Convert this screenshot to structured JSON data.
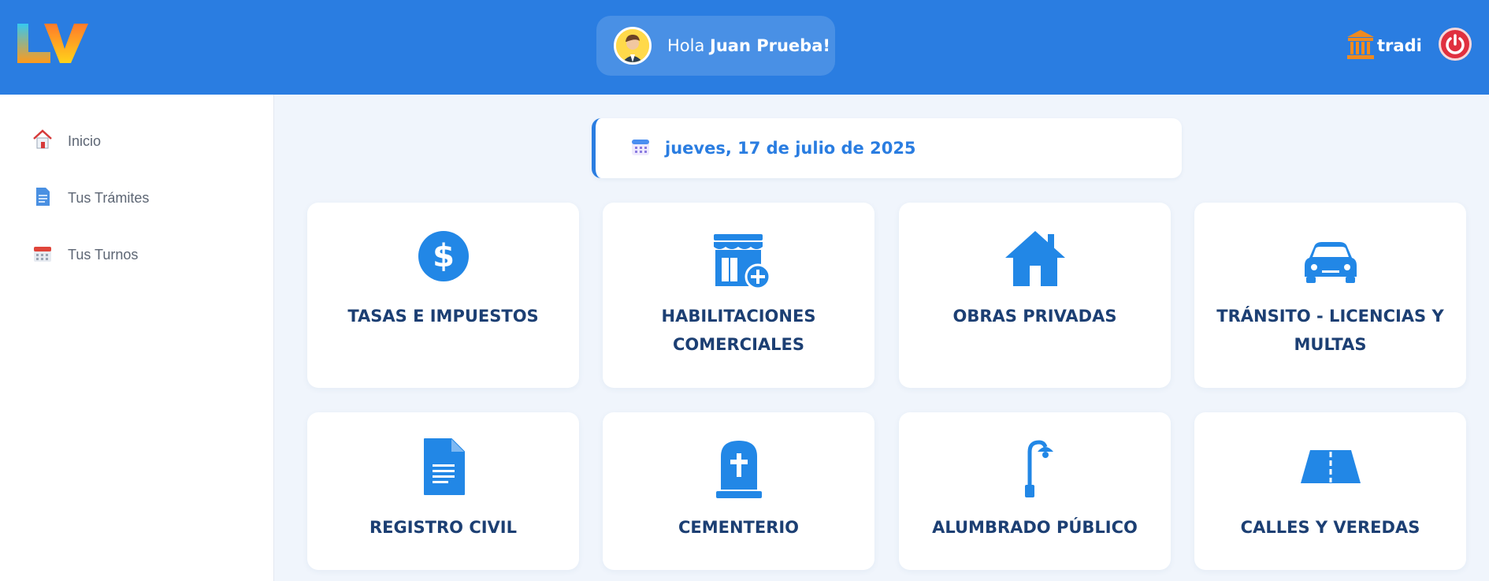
{
  "header": {
    "greeting_prefix": "Hola",
    "user_name": "Juan Prueba!",
    "brand": "tradi",
    "accent": "#2a7de1",
    "logo_icon": "lv-logo-icon",
    "power_icon": "power-icon"
  },
  "sidebar": {
    "items": [
      {
        "label": "Inicio",
        "icon": "home-icon"
      },
      {
        "label": "Tus Trámites",
        "icon": "document-icon"
      },
      {
        "label": "Tus Turnos",
        "icon": "calendar-icon"
      }
    ]
  },
  "date": "jueves, 17 de julio de 2025",
  "cards": [
    {
      "title": "TASAS E IMPUESTOS",
      "icon": "dollar-icon"
    },
    {
      "title": "HABILITACIONES COMERCIALES",
      "icon": "store-add-icon"
    },
    {
      "title": "OBRAS PRIVADAS",
      "icon": "house-icon"
    },
    {
      "title": "TRÁNSITO - LICENCIAS Y MULTAS",
      "icon": "car-icon"
    },
    {
      "title": "REGISTRO CIVIL",
      "icon": "document-icon"
    },
    {
      "title": "CEMENTERIO",
      "icon": "tombstone-icon"
    },
    {
      "title": "ALUMBRADO PÚBLICO",
      "icon": "street-lamp-icon"
    },
    {
      "title": "CALLES Y VEREDAS",
      "icon": "road-icon"
    }
  ]
}
